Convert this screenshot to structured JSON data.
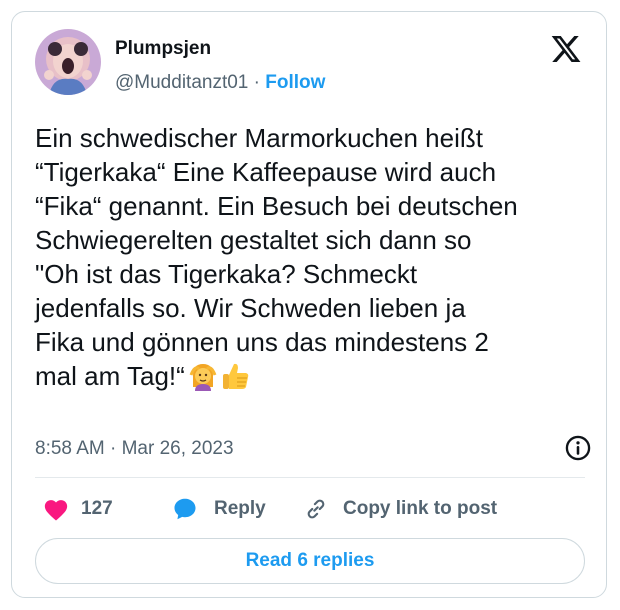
{
  "author": {
    "display_name": "Plumpsjen",
    "handle": "@Mudditanzt01",
    "separator": "·",
    "follow_label": "Follow"
  },
  "tweet": {
    "text": "Ein schwedischer Marmorkuchen heißt\n“Tigerkaka“ Eine Kaffeepause wird auch\n“Fika“ genannt. Ein Besuch bei deutschen\nSchwiegerelten gestaltet sich dann so\n\"Oh ist das Tigerkaka? Schmeckt\njedenfalls so. Wir Schweden lieben ja\nFika und gönnen uns das mindestens 2\nmal am Tag!“",
    "emojis": [
      "woman-gesturing-ok",
      "thumbs-up"
    ],
    "time": "8:58 AM",
    "date_separator": "·",
    "date": "Mar 26, 2023"
  },
  "actions": {
    "like_count": "127",
    "reply_label": "Reply",
    "copy_label": "Copy link to post"
  },
  "read_replies_label": "Read 6 replies",
  "icons": {
    "logo": "x-logo-icon",
    "info": "info-icon",
    "like": "heart-icon",
    "reply": "speech-bubble-icon",
    "copy": "link-icon"
  },
  "colors": {
    "accent": "#1d9bf0",
    "like": "#f91880",
    "text": "#0f1419",
    "muted": "#536471",
    "border": "#cfd9de"
  }
}
